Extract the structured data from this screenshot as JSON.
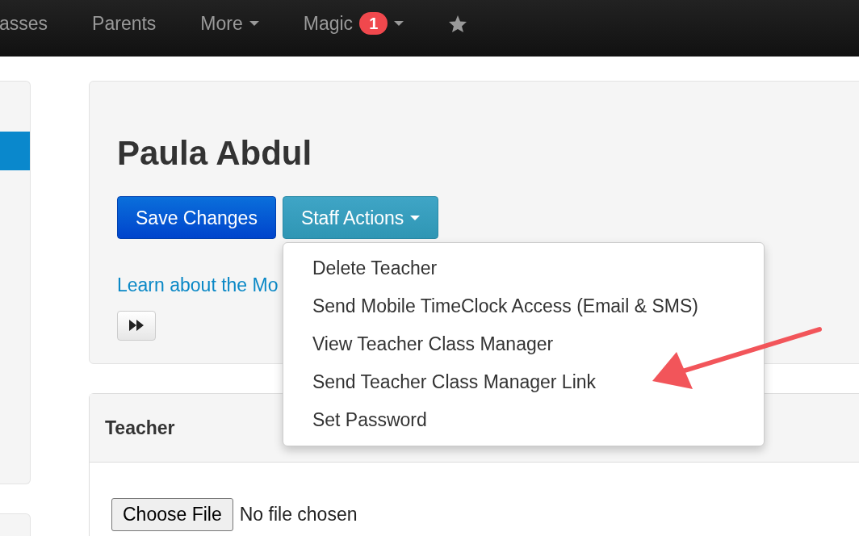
{
  "navbar": {
    "items": [
      {
        "label": "asses",
        "kind": "link"
      },
      {
        "label": "Parents",
        "kind": "link"
      },
      {
        "label": "More",
        "kind": "dropdown"
      },
      {
        "label": "Magic",
        "kind": "dropdown",
        "badge": "1"
      },
      {
        "kind": "star"
      }
    ]
  },
  "profile": {
    "name": "Paula Abdul",
    "buttons": [
      {
        "label": "Save Changes",
        "kind": "primary"
      },
      {
        "label": "Staff Actions",
        "kind": "dropdown"
      }
    ],
    "learn_link": "Learn about the Mo",
    "actions_menu": {
      "expanded": true,
      "items": [
        {
          "label": "Delete Teacher"
        },
        {
          "label": "Send Mobile TimeClock Access (Email & SMS)"
        },
        {
          "label": "View Teacher Class Manager"
        },
        {
          "label": "Send Teacher Class Manager Link"
        },
        {
          "label": "Set Password"
        }
      ]
    }
  },
  "teacher_card": {
    "title": "Teacher",
    "file_input": {
      "button": "Choose File",
      "status": "No file chosen"
    }
  }
}
